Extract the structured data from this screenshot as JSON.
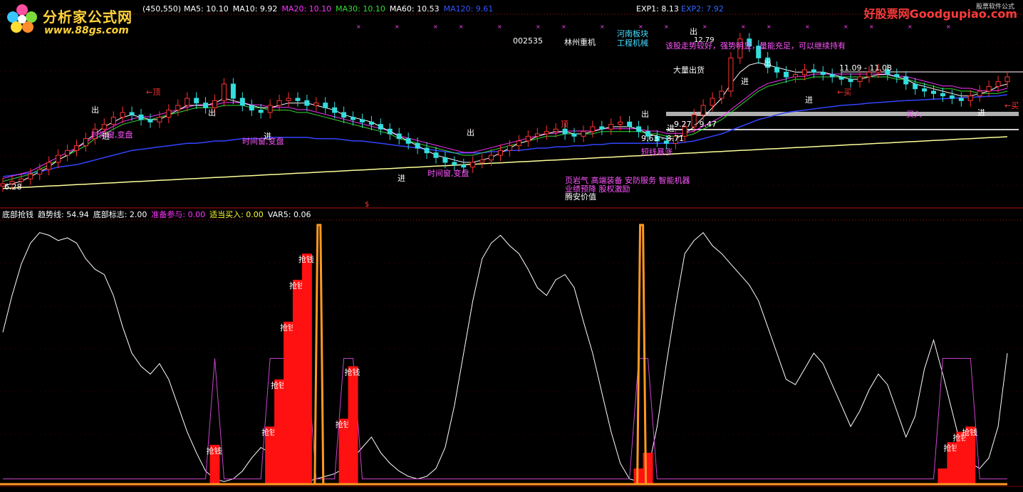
{
  "top_header": {
    "params": "(450,550)",
    "items": [
      {
        "label": "MA5:",
        "value": "10.10",
        "color": "#ffffff"
      },
      {
        "label": "MA10:",
        "value": "9.92",
        "color": "#ffffff"
      },
      {
        "label": "MA20:",
        "value": "10.10",
        "color": "#ff33ff"
      },
      {
        "label": "MA30:",
        "value": "10.10",
        "color": "#33dd33"
      },
      {
        "label": "MA60:",
        "value": "10.53",
        "color": "#ffffff"
      },
      {
        "label": "MA120:",
        "value": "9.61",
        "color": "#3355ff"
      }
    ],
    "exp1": "EXP1: 8.13",
    "exp2": "EXP2: 7.92"
  },
  "logo": {
    "title": "分析家公式网",
    "url": "www.88gs.com"
  },
  "brand": {
    "name": "好股票网",
    "domain": "Goodgupiao.com",
    "tag": "股票软件公式"
  },
  "stock": {
    "code": "002535",
    "name": "林州重机",
    "sector": [
      "河南板块",
      "工程机械"
    ],
    "comment": "该股走势较好，强势明显，量能充足，可以继续持有",
    "concepts": [
      "页岩气 高端装备 安防服务 智能机器",
      "业绩预降 股权激励"
    ],
    "value_tag": "腾安价值"
  },
  "annotations": {
    "top_price": "12.79",
    "range_label": "11.09 - 11.08",
    "price_low": "6.28",
    "range2": "9.27 - 9.47",
    "range3": "9.63 - 8.71",
    "dollar": "$",
    "jin": "进",
    "chu": "出",
    "ding": "顶",
    "ding_arrow": "←顶",
    "time_window": "时间窗,变盘",
    "short_surge": "短线暴涨",
    "big_chu": "大量出货",
    "mai": "买",
    "mai_arrow": "←买",
    "mairu": "买入"
  },
  "bottom_header": {
    "name": "底部抢钱",
    "items": [
      {
        "label": "趋势线:",
        "value": "54.94",
        "color": "#ffffff"
      },
      {
        "label": "底部标志:",
        "value": "2.00",
        "color": "#ffffff"
      },
      {
        "label": "准备参与:",
        "value": "0.00",
        "color": "#ff33ff"
      },
      {
        "label": "适当买入:",
        "value": "0.00",
        "color": "#ffff33"
      },
      {
        "label": "VAR5:",
        "value": "0.06",
        "color": "#ffffff"
      }
    ]
  },
  "signal_label": "抢钱",
  "chart_data": {
    "type": "line",
    "panels": [
      {
        "name": "price",
        "ylim": [
          6.0,
          13.2
        ],
        "kline": [
          6.3,
          6.4,
          6.5,
          6.7,
          6.9,
          7.2,
          7.5,
          7.7,
          7.9,
          8.2,
          8.6,
          8.8,
          9.1,
          9.3,
          9.2,
          9.0,
          8.9,
          9.1,
          9.4,
          9.6,
          9.9,
          9.7,
          9.5,
          9.8,
          10.5,
          9.9,
          9.6,
          9.4,
          9.3,
          9.6,
          9.8,
          9.9,
          9.8,
          9.6,
          9.7,
          9.5,
          9.3,
          9.1,
          9.0,
          8.9,
          8.8,
          8.6,
          8.4,
          8.2,
          8.0,
          7.8,
          7.6,
          7.4,
          7.2,
          7.1,
          7.0,
          7.2,
          7.3,
          7.5,
          7.7,
          7.9,
          8.1,
          8.3,
          8.4,
          8.5,
          8.6,
          8.4,
          8.3,
          8.5,
          8.7,
          8.6,
          8.8,
          8.9,
          8.7,
          8.5,
          8.3,
          8.1,
          8.0,
          8.3,
          8.7,
          9.2,
          9.6,
          9.9,
          10.2,
          11.6,
          12.4,
          12.1,
          11.6,
          11.2,
          11.0,
          10.8,
          10.9,
          11.1,
          11.0,
          10.9,
          10.8,
          10.7,
          10.6,
          10.8,
          11.0,
          11.1,
          10.9,
          10.8,
          10.5,
          10.3,
          10.2,
          10.1,
          10.0,
          9.9,
          9.8,
          10.0,
          10.2,
          10.4,
          10.6,
          10.8
        ],
        "ma_fast": [
          6.2,
          6.3,
          6.4,
          6.6,
          6.8,
          7.0,
          7.3,
          7.5,
          7.8,
          8.1,
          8.4,
          8.7,
          8.9,
          9.1,
          9.2,
          9.1,
          9.0,
          9.0,
          9.2,
          9.4,
          9.6,
          9.6,
          9.6,
          9.7,
          9.9,
          9.8,
          9.7,
          9.6,
          9.5,
          9.5,
          9.6,
          9.7,
          9.7,
          9.7,
          9.6,
          9.5,
          9.4,
          9.2,
          9.1,
          9.0,
          8.9,
          8.7,
          8.5,
          8.3,
          8.1,
          7.9,
          7.7,
          7.5,
          7.4,
          7.3,
          7.2,
          7.2,
          7.3,
          7.4,
          7.6,
          7.8,
          8.0,
          8.1,
          8.3,
          8.4,
          8.5,
          8.5,
          8.4,
          8.4,
          8.5,
          8.6,
          8.7,
          8.7,
          8.7,
          8.6,
          8.4,
          8.3,
          8.2,
          8.2,
          8.4,
          8.7,
          9.1,
          9.5,
          9.9,
          10.5,
          11.0,
          11.3,
          11.4,
          11.3,
          11.2,
          11.1,
          11.0,
          11.0,
          11.0,
          11.0,
          10.9,
          10.8,
          10.7,
          10.7,
          10.8,
          10.9,
          10.9,
          10.8,
          10.7,
          10.5,
          10.4,
          10.3,
          10.2,
          10.1,
          10.0,
          10.0,
          10.1,
          10.2,
          10.4,
          10.5
        ],
        "ma_mid": [
          6.4,
          6.5,
          6.6,
          6.7,
          6.9,
          7.1,
          7.3,
          7.5,
          7.7,
          7.9,
          8.2,
          8.4,
          8.6,
          8.8,
          8.9,
          9.0,
          9.0,
          9.1,
          9.2,
          9.3,
          9.4,
          9.5,
          9.5,
          9.5,
          9.6,
          9.6,
          9.6,
          9.5,
          9.5,
          9.4,
          9.4,
          9.4,
          9.3,
          9.3,
          9.2,
          9.1,
          9.0,
          8.9,
          8.8,
          8.7,
          8.6,
          8.5,
          8.4,
          8.2,
          8.1,
          8.0,
          7.9,
          7.8,
          7.7,
          7.6,
          7.5,
          7.5,
          7.6,
          7.7,
          7.8,
          7.9,
          8.0,
          8.1,
          8.2,
          8.3,
          8.3,
          8.4,
          8.4,
          8.4,
          8.4,
          8.5,
          8.5,
          8.5,
          8.5,
          8.5,
          8.4,
          8.4,
          8.3,
          8.3,
          8.3,
          8.4,
          8.6,
          8.8,
          9.0,
          9.3,
          9.6,
          9.9,
          10.2,
          10.4,
          10.5,
          10.6,
          10.7,
          10.7,
          10.8,
          10.8,
          10.8,
          10.8,
          10.8,
          10.8,
          10.8,
          10.8,
          10.8,
          10.7,
          10.7,
          10.6,
          10.5,
          10.4,
          10.3,
          10.3,
          10.2,
          10.2,
          10.1,
          10.1,
          10.1,
          10.2
        ],
        "ma_slow": [
          6.6,
          6.65,
          6.7,
          6.75,
          6.8,
          6.9,
          7.0,
          7.05,
          7.1,
          7.2,
          7.3,
          7.4,
          7.5,
          7.6,
          7.7,
          7.75,
          7.8,
          7.85,
          7.9,
          7.95,
          8.0,
          8.0,
          8.05,
          8.1,
          8.1,
          8.15,
          8.2,
          8.2,
          8.2,
          8.25,
          8.25,
          8.25,
          8.25,
          8.25,
          8.2,
          8.2,
          8.2,
          8.15,
          8.1,
          8.1,
          8.05,
          8.0,
          7.95,
          7.9,
          7.85,
          7.8,
          7.75,
          7.7,
          7.65,
          7.6,
          7.6,
          7.6,
          7.6,
          7.65,
          7.65,
          7.7,
          7.7,
          7.75,
          7.8,
          7.8,
          7.85,
          7.85,
          7.9,
          7.9,
          7.95,
          7.95,
          8.0,
          8.0,
          8.0,
          8.0,
          8.0,
          8.0,
          8.0,
          8.0,
          8.05,
          8.1,
          8.2,
          8.3,
          8.4,
          8.55,
          8.7,
          8.85,
          9.0,
          9.1,
          9.2,
          9.3,
          9.35,
          9.4,
          9.45,
          9.5,
          9.55,
          9.6,
          9.62,
          9.65,
          9.7,
          9.72,
          9.75,
          9.78,
          9.8,
          9.82,
          9.84,
          9.86,
          9.88,
          9.9,
          9.92,
          9.94,
          9.96,
          9.98,
          10.0,
          10.05
        ],
        "long_line": [
          6.1,
          6.12,
          6.14,
          6.16,
          6.18,
          6.2,
          6.22,
          6.24,
          6.26,
          6.28,
          6.3,
          6.32,
          6.34,
          6.36,
          6.38,
          6.4,
          6.42,
          6.44,
          6.46,
          6.48,
          6.5,
          6.52,
          6.54,
          6.56,
          6.58,
          6.6,
          6.62,
          6.64,
          6.66,
          6.68,
          6.7,
          6.72,
          6.74,
          6.76,
          6.78,
          6.8,
          6.82,
          6.84,
          6.86,
          6.88,
          6.9,
          6.92,
          6.94,
          6.96,
          6.98,
          7.0,
          7.02,
          7.04,
          7.06,
          7.08,
          7.1,
          7.12,
          7.14,
          7.16,
          7.18,
          7.2,
          7.22,
          7.24,
          7.26,
          7.28,
          7.3,
          7.32,
          7.34,
          7.36,
          7.38,
          7.4,
          7.42,
          7.44,
          7.46,
          7.48,
          7.5,
          7.52,
          7.54,
          7.56,
          7.58,
          7.6,
          7.62,
          7.64,
          7.66,
          7.68,
          7.7,
          7.72,
          7.74,
          7.76,
          7.78,
          7.8,
          7.82,
          7.84,
          7.86,
          7.88,
          7.9,
          7.92,
          7.94,
          7.96,
          7.98,
          8.0,
          8.02,
          8.04,
          8.06,
          8.08,
          8.1,
          8.12,
          8.14,
          8.16,
          8.18,
          8.2,
          8.22,
          8.24,
          8.26,
          8.28
        ]
      },
      {
        "name": "底部抢钱",
        "ylim": [
          0,
          100
        ],
        "trend_line": [
          58,
          72,
          84,
          92,
          96,
          95,
          93,
          94,
          92,
          86,
          82,
          80,
          72,
          60,
          50,
          45,
          42,
          46,
          40,
          30,
          20,
          12,
          5,
          2,
          1,
          2,
          5,
          10,
          14,
          12,
          8,
          4,
          2,
          1,
          2,
          3,
          4,
          6,
          10,
          14,
          18,
          12,
          8,
          5,
          3,
          2,
          3,
          6,
          14,
          30,
          50,
          70,
          86,
          92,
          95,
          91,
          88,
          82,
          75,
          72,
          78,
          80,
          75,
          62,
          50,
          35,
          20,
          8,
          2,
          1,
          5,
          22,
          46,
          68,
          88,
          93,
          96,
          91,
          88,
          84,
          80,
          76,
          70,
          60,
          50,
          40,
          38,
          44,
          50,
          46,
          38,
          30,
          22,
          28,
          36,
          42,
          38,
          28,
          18,
          26,
          44,
          55,
          42,
          28,
          14,
          8,
          6,
          10,
          22,
          50
        ],
        "signal_values": [
          0,
          0,
          0,
          0,
          0,
          0,
          0,
          0,
          0,
          0,
          0,
          0,
          0,
          0,
          0,
          0,
          0,
          0,
          0,
          0,
          0,
          0,
          0,
          15,
          0,
          0,
          0,
          0,
          0,
          22,
          40,
          62,
          78,
          88,
          0,
          0,
          0,
          25,
          45,
          0,
          0,
          0,
          0,
          0,
          0,
          0,
          0,
          0,
          0,
          0,
          0,
          0,
          0,
          0,
          0,
          0,
          0,
          0,
          0,
          0,
          0,
          0,
          0,
          0,
          0,
          0,
          0,
          0,
          0,
          6,
          12,
          0,
          0,
          0,
          0,
          0,
          0,
          0,
          0,
          0,
          0,
          0,
          0,
          0,
          0,
          0,
          0,
          0,
          0,
          0,
          0,
          0,
          0,
          0,
          0,
          0,
          0,
          0,
          0,
          0,
          0,
          0,
          6,
          16,
          20,
          22,
          0,
          0,
          0,
          0,
          0,
          0,
          4,
          4,
          0,
          0,
          0
        ],
        "spikes": [
          34,
          69
        ]
      }
    ]
  }
}
